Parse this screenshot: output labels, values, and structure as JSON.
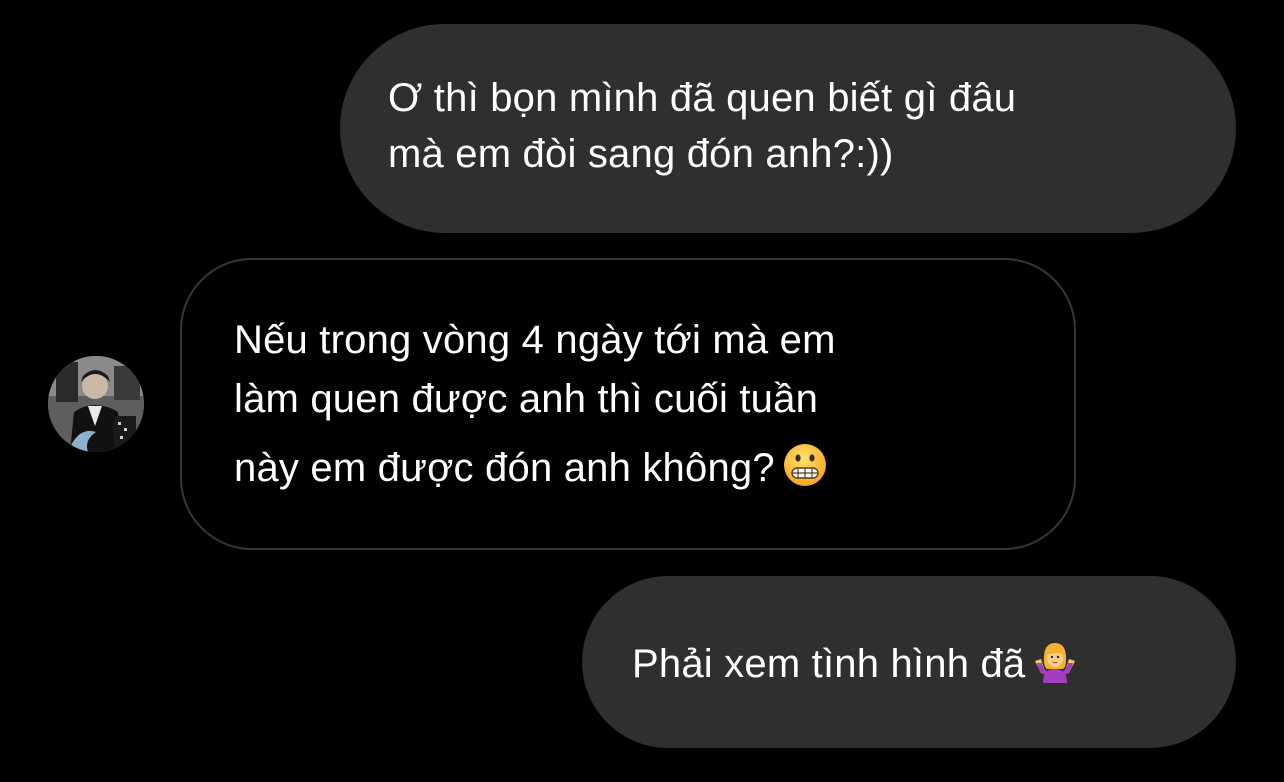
{
  "conversation": {
    "messages": [
      {
        "sender": "me",
        "lines": [
          "Ơ thì bọn mình đã quen biết gì đâu",
          "mà em đòi sang đón anh?:))"
        ]
      },
      {
        "sender": "them",
        "lines": [
          "Nếu trong vòng 4 ngày tới mà em",
          "làm quen được anh thì cuối tuần",
          "này em được đón anh không?"
        ],
        "emoji": "grimacing-face-emoji"
      },
      {
        "sender": "me",
        "lines": [
          "Phải xem tình hình đã"
        ],
        "emoji": "woman-shrugging-emoji"
      }
    ]
  },
  "colors": {
    "background": "#000000",
    "outgoing_bubble": "#2f2f2f",
    "incoming_bubble_border": "#363636",
    "text": "#ffffff"
  }
}
